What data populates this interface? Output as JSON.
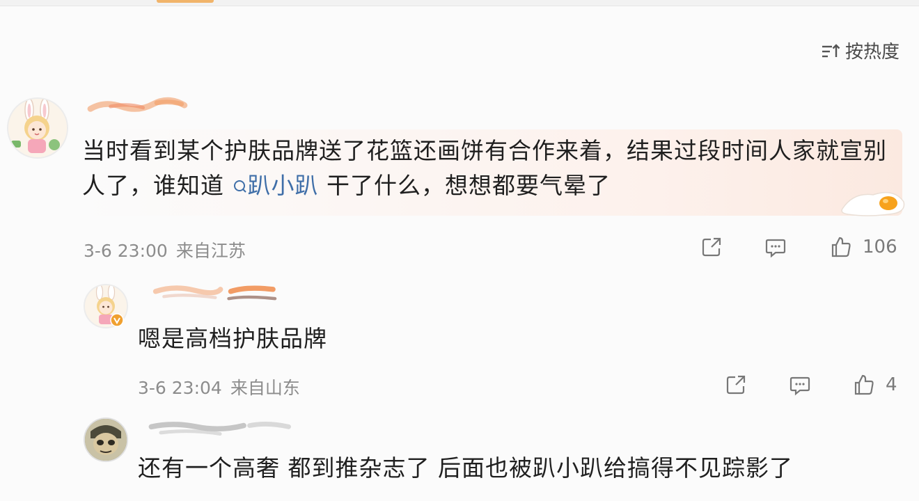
{
  "sort": {
    "label": "按热度",
    "icon": "sort-hot-icon"
  },
  "comments": [
    {
      "avatar_icon": "bunny-girl-avatar",
      "text_before": "当时看到某个护肤品牌送了花篮还画饼有合作来着，结果过段时间人家就宣别人了，谁知道",
      "topic": "趴小趴",
      "text_after": " 干了什么，想想都要气晕了",
      "date": "3-6 23:00",
      "location": "来自江苏",
      "likes": "106",
      "decoration_icon": "fried-egg-icon"
    },
    {
      "avatar_icon": "bunny-girl-avatar-verified",
      "text": "嗯是高档护肤品牌",
      "date": "3-6 23:04",
      "location": "来自山东",
      "likes": "4"
    },
    {
      "avatar_icon": "character-avatar",
      "text": "还有一个高奢 都到推杂志了 后面也被趴小趴给搞得不见踪影了"
    }
  ],
  "colors": {
    "topic_link": "#3f6ea8",
    "meta_text": "#8c8c8c",
    "highlight": "#fbe9e0",
    "verified_badge": "#f0a030"
  }
}
